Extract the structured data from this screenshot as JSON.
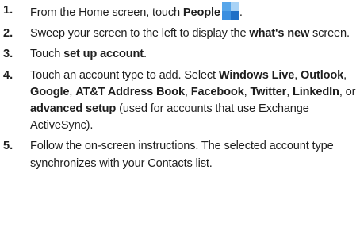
{
  "steps": [
    {
      "number": "1.",
      "parts": [
        "From the Home screen, touch ",
        "People",
        "."
      ],
      "icon": "people-tile-icon"
    },
    {
      "number": "2.",
      "parts": [
        "Sweep your screen to the left to display the ",
        "what's new",
        " screen."
      ]
    },
    {
      "number": "3.",
      "parts": [
        "Touch ",
        "set up account",
        "."
      ]
    },
    {
      "number": "4.",
      "parts": [
        "Touch an account type to add. Select ",
        "Windows Live",
        ", ",
        "Outlook",
        ", ",
        "Google",
        ", ",
        "AT&T Address Book",
        ", ",
        "Facebook",
        ", ",
        "Twitter",
        ", ",
        "LinkedIn",
        ", or ",
        "advanced setup",
        " (used for accounts that use Exchange ActiveSync)."
      ]
    },
    {
      "number": "5.",
      "parts": [
        "Follow the on-screen instructions. The selected account type synchronizes with your Contacts list."
      ]
    }
  ]
}
